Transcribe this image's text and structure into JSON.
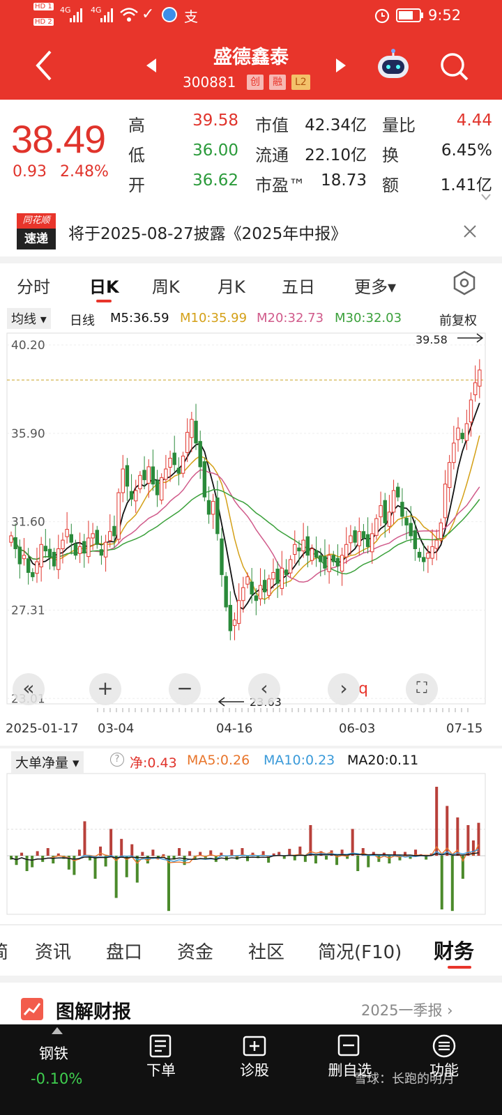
{
  "status_bar": {
    "left_badges": [
      "HD 1",
      "HD 2"
    ],
    "signal_1": "4G",
    "signal_2": "4G",
    "battery": "",
    "time": "9:52"
  },
  "header": {
    "stock_name": "盛德鑫泰",
    "stock_code": "300881",
    "tags": [
      "创",
      "融",
      "L2"
    ],
    "icons": [
      "back-icon",
      "prev-icon",
      "next-icon",
      "robot-icon",
      "search-icon"
    ]
  },
  "quote": {
    "price": "38.49",
    "change": "0.93",
    "change_pct": "2.48%",
    "rows": [
      {
        "l1": "高",
        "v1": "39.58",
        "c1": "red",
        "l2": "市值",
        "v2": "42.34亿",
        "l3": "量比",
        "v3": "4.44",
        "c3": "red"
      },
      {
        "l1": "低",
        "v1": "36.00",
        "c1": "green",
        "l2": "流通",
        "v2": "22.10亿",
        "l3": "换",
        "v3": "6.45%",
        "c3": "dark"
      },
      {
        "l1": "开",
        "v1": "36.62",
        "c1": "green",
        "l2": "市盈™",
        "v2": "18.73",
        "l3": "额",
        "v3": "1.41亿",
        "c3": "dark"
      }
    ],
    "colors": {
      "up": "#e0332b",
      "down": "#2a9a3a"
    }
  },
  "notice": {
    "logo_top": "同花顺",
    "logo_bottom": "速递",
    "text": "将于2025-08-27披露《2025年中报》"
  },
  "period_tabs": [
    "分时",
    "日K",
    "周K",
    "月K",
    "五日",
    "更多▾"
  ],
  "ma_bar": {
    "selector": "均线 ▾",
    "period": "日线",
    "m5": "M5:36.59",
    "m10": "M10:35.99",
    "m20": "M20:32.73",
    "m30": "M30:32.03",
    "adjust": "前复权",
    "colors": {
      "m5": "#111111",
      "m10": "#d4a017",
      "m20": "#d05a8a",
      "m30": "#3aa03a"
    }
  },
  "chart_data": {
    "type": "candlestick",
    "y_ticks": [
      "40.20",
      "35.90",
      "31.60",
      "27.31",
      "23.01"
    ],
    "ylim": [
      23.01,
      40.2
    ],
    "x_ticks": [
      "2025-01-17",
      "03-04",
      "04-16",
      "06-03",
      "07-15"
    ],
    "annotations": {
      "high_label": "39.58",
      "low_label": "23.63",
      "marker": "q"
    },
    "close_series": [
      30.8,
      30.2,
      29.5,
      29.9,
      29.1,
      28.9,
      29.6,
      30.4,
      30.1,
      29.8,
      29.4,
      30.2,
      30.6,
      31.1,
      30.5,
      29.9,
      30.3,
      30.0,
      30.7,
      30.9,
      30.4,
      29.9,
      30.5,
      31.0,
      30.8,
      32.8,
      33.9,
      33.1,
      32.5,
      32.9,
      33.6,
      33.4,
      34.0,
      33.2,
      32.7,
      33.5,
      33.9,
      34.4,
      34.1,
      33.7,
      34.5,
      35.6,
      36.2,
      35.1,
      34.0,
      32.6,
      31.8,
      32.4,
      30.9,
      29.0,
      27.5,
      26.4,
      26.9,
      27.8,
      28.4,
      28.9,
      28.1,
      27.8,
      28.5,
      28.2,
      28.8,
      29.1,
      28.6,
      29.3,
      29.0,
      29.7,
      30.4,
      30.1,
      30.6,
      29.9,
      30.2,
      29.8,
      29.6,
      29.3,
      29.9,
      29.6,
      29.4,
      29.9,
      30.4,
      30.8,
      30.5,
      31.0,
      30.7,
      30.3,
      30.9,
      31.6,
      32.2,
      31.4,
      31.9,
      32.9,
      32.6,
      31.7,
      31.3,
      30.8,
      30.2,
      29.8,
      29.6,
      30.0,
      30.3,
      30.6,
      31.4,
      33.2,
      34.2,
      35.1,
      35.8,
      35.3,
      36.0,
      37.1,
      37.9,
      38.49
    ],
    "ma_current": {
      "M5": 36.59,
      "M10": 35.99,
      "M20": 32.73,
      "M30": 32.03
    }
  },
  "chart_controls": [
    "«",
    "+",
    "−",
    "‹",
    "›",
    "⛶"
  ],
  "flow_bar": {
    "selector": "大单净量 ▾",
    "net": "净:0.43",
    "ma5": "MA5:0.26",
    "ma10": "MA10:0.23",
    "ma20": "MA20:0.11",
    "values": [
      -0.05,
      -0.12,
      0.04,
      -0.2,
      -0.15,
      0.06,
      -0.08,
      0.1,
      -0.1,
      0.03,
      -0.04,
      -0.18,
      -0.25,
      0.08,
      0.45,
      -0.06,
      -0.3,
      0.12,
      -0.14,
      0.35,
      -0.55,
      0.22,
      -0.28,
      0.15,
      -0.35,
      0.05,
      -0.1,
      0.08,
      -0.04,
      0.02,
      -0.72,
      -0.05,
      0.1,
      -0.12,
      0.06,
      -0.04,
      0.05,
      -0.03,
      0.07,
      -0.08,
      0.04,
      -0.06,
      0.08,
      -0.05,
      0.1,
      -0.07,
      0.04,
      -0.03,
      0.06,
      -0.09,
      0.03,
      0.05,
      -0.04,
      0.09,
      -0.06,
      0.12,
      -0.08,
      0.4,
      -0.1,
      0.06,
      -0.05,
      0.07,
      -0.12,
      0.08,
      -0.04,
      0.35,
      -0.2,
      0.1,
      -0.15,
      0.05,
      -0.08,
      0.04,
      -0.1,
      0.06,
      -0.06,
      0.05,
      -0.04,
      0.08,
      0.02,
      -0.05,
      0.03,
      0.9,
      -0.7,
      0.65,
      -0.72,
      0.5,
      -0.3,
      0.4,
      0.2,
      0.43
    ]
  },
  "bottom_tabs": [
    "简",
    "资讯",
    "盘口",
    "资金",
    "社区",
    "简况(F10)",
    "财务"
  ],
  "report": {
    "title": "图解财报",
    "period": "2025一季报 ›"
  },
  "bottom_nav": {
    "market_name": "钢铁",
    "market_chg": "-0.10%",
    "items": [
      "下单",
      "诊股",
      "删自选",
      "功能"
    ],
    "watermark": "雪球：长跑的明月"
  }
}
